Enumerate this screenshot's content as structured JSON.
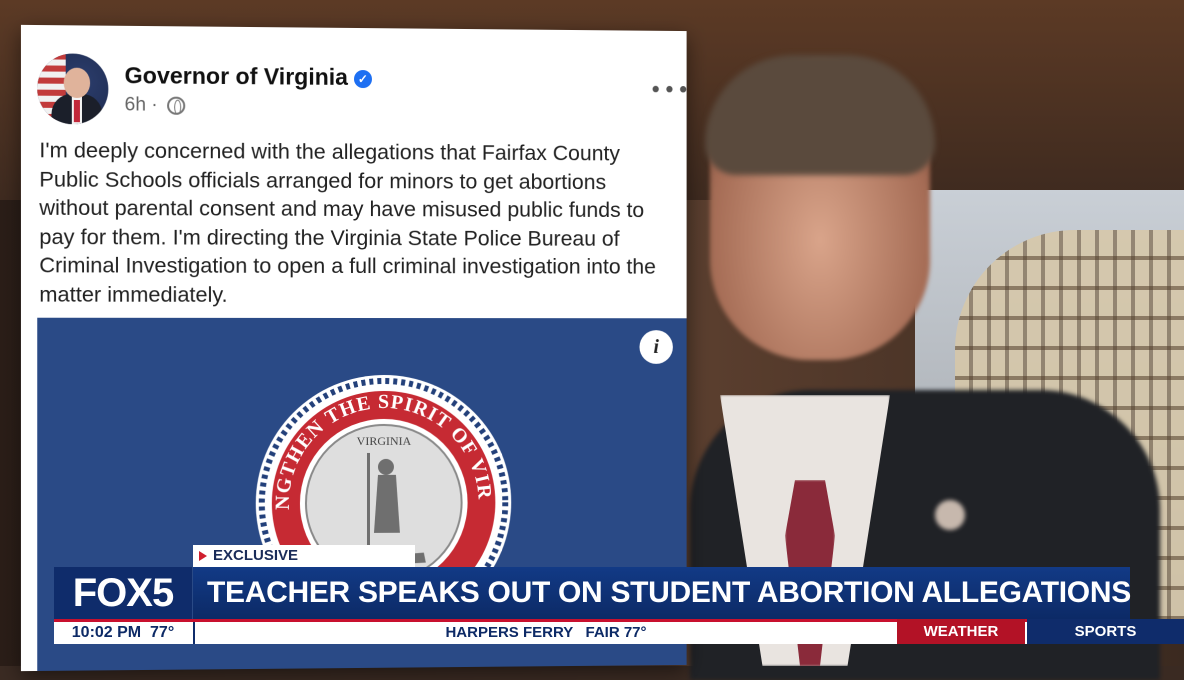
{
  "post": {
    "author": "Governor of Virginia",
    "verified_icon": "verified-badge-icon",
    "time": "6h",
    "separator": "·",
    "audience_icon": "globe-icon",
    "more_icon": "more-options-icon",
    "more_glyph": "•••",
    "text": "I'm deeply concerned with the allegations that Fairfax County Public Schools officials arranged for minors to get abortions without parental consent and may have misused public funds to pay for them. I'm directing the Virginia State Police Bureau of Criminal Investigation to open a full criminal investigation into the matter immediately.",
    "info_glyph": "i",
    "seal_motto": "STRENGTHEN THE SPIRIT OF VIRGINIA",
    "seal_inner": "VIRGINIA"
  },
  "lower_third": {
    "tag": "EXCLUSIVE",
    "logo": "FOX5",
    "headline": "TEACHER SPEAKS OUT ON STUDENT ABORTION ALLEGATIONS",
    "time": "10:02 PM",
    "temp": "77°",
    "ticker": "HARPERS FERRY   FAIR 77°",
    "weather": "WEATHER",
    "sports": "SPORTS"
  },
  "colors": {
    "fb_blue": "#1d6ff2",
    "banner_blue": "#2a4a86",
    "fox_navy": "#0f2c6b",
    "fox_red": "#c8102e"
  }
}
